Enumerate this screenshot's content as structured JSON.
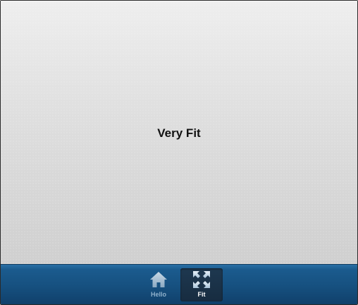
{
  "content": {
    "title": "Very Fit"
  },
  "tabbar": {
    "tabs": [
      {
        "label": "Hello",
        "icon": "home-icon",
        "selected": false
      },
      {
        "label": "Fit",
        "icon": "expand-arrows-icon",
        "selected": true
      }
    ]
  },
  "colors": {
    "tabbar": "#16507f",
    "tab_selected": "#1e3850",
    "tab_label_inactive": "#8fb1cc",
    "tab_label_active": "#ffffff",
    "content_background": "#dedede",
    "title": "#111111"
  }
}
